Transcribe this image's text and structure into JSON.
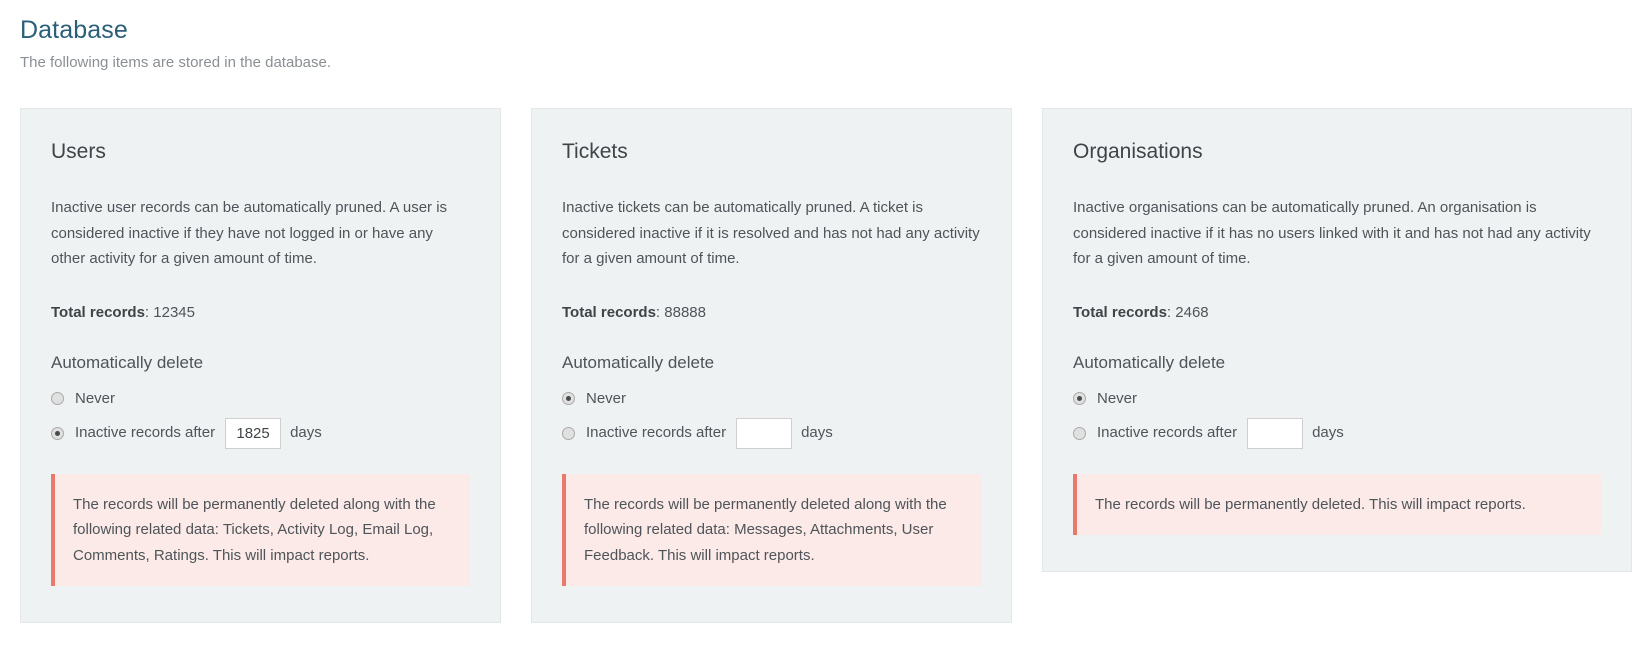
{
  "header": {
    "title": "Database",
    "subtitle": "The following items are stored in the database."
  },
  "cards": [
    {
      "title": "Users",
      "description": "Inactive user records can be automatically pruned. A user is considered inactive if they have not logged in or have any other activity for a given amount of time.",
      "total_records_label": "Total records",
      "total_records_value": ": 12345",
      "total_records_count": "12345",
      "section_label": "Automatically delete",
      "option_never": "Never",
      "option_inactive": "Inactive records after",
      "days_suffix": "days",
      "days_value": "1825",
      "selected": "inactive",
      "warning": "The records will be permanently deleted along with the following related data: Tickets, Activity Log, Email Log, Comments, Ratings. This will impact reports."
    },
    {
      "title": "Tickets",
      "description": "Inactive tickets can be automatically pruned. A ticket is considered inactive if it is resolved and has not had any activity for a given amount of time.",
      "total_records_label": "Total records",
      "total_records_value": ": 88888",
      "total_records_count": "88888",
      "section_label": "Automatically delete",
      "option_never": "Never",
      "option_inactive": "Inactive records after",
      "days_suffix": "days",
      "days_value": "",
      "selected": "never",
      "warning": "The records will be permanently deleted along with the following related data: Messages, Attachments, User Feedback. This will impact reports."
    },
    {
      "title": "Organisations",
      "description": "Inactive organisations can be automatically pruned. An organisation is considered inactive if it has no users linked with it and has not had any activity for a given amount of time.",
      "total_records_label": "Total records",
      "total_records_value": ": 2468",
      "total_records_count": "2468",
      "section_label": "Automatically delete",
      "option_never": "Never",
      "option_inactive": "Inactive records after",
      "days_suffix": "days",
      "days_value": "",
      "selected": "never",
      "warning": "The records will be permanently deleted. This will impact reports."
    }
  ],
  "colors": {
    "title": "#2b5f77",
    "card_background": "#eef2f3",
    "warning_background": "#fbeae7",
    "warning_accent": "#e8796b",
    "text": "#4e5459"
  }
}
